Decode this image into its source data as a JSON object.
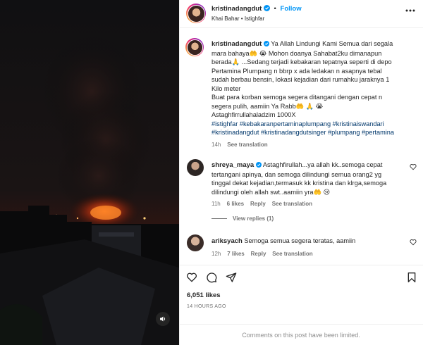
{
  "header": {
    "username": "kristinadangdut",
    "follow_label": "Follow",
    "bullet": "•",
    "subline": "Khai Bahar • Istighfar",
    "more_icon": "more-horizontal-icon"
  },
  "caption": {
    "username": "kristinadangdut",
    "lines": [
      " Ya Allah Lindungi Kami Semua dari segala",
      "mara bahaya🤲 😭 Mohon doanya Sahabat2ku dimanapun",
      "berada🙏 ...Sedang terjadi kebakaran tepatnya seperti di depo",
      "Pertamina Plumpang n bbrp x ada ledakan n asapnya tebal",
      "sudah berbau bensin, lokasi kejadian dari rumahku jaraknya 1",
      "Kilo meter",
      "Buat para korban semoga segera ditangani dengan cepat n",
      "segera pulih, aamiin Ya Rabb🤲 🙏 😭",
      "Astaghfirrullahaladzim 1000X"
    ],
    "hashtags_line1": [
      "#istighfar",
      "#kebakaranpertaminaplumpang",
      "#kristinaiswandari"
    ],
    "hashtags_line2": [
      "#kristinadangdut",
      "#kristinadangdutsinger",
      "#plumpang",
      "#pertamina"
    ],
    "time": "14h",
    "see_translation": "See translation"
  },
  "comments": [
    {
      "username": "shreya_maya",
      "lines": [
        " Astaghfirullah...ya allah kk..semoga cepat",
        "tertangani apinya, dan semoga dilindungi semua orang2 yg",
        "tinggal dekat kejadian,termasuk kk kristina dan klrga,semoga",
        "dilindungi oleh allah swt..aamiin yra🤲 😢"
      ],
      "time": "11h",
      "likes": "6 likes",
      "reply": "Reply",
      "see_translation": "See translation",
      "view_replies": "View replies (1)"
    },
    {
      "username": "ariksyach",
      "lines": [
        " Semoga semua segera teratas, aamiin"
      ],
      "time": "12h",
      "likes": "7 likes",
      "reply": "Reply",
      "see_translation": "See translation"
    }
  ],
  "actions": {
    "likes": "6,051 likes",
    "date": "14 HOURS AGO",
    "icons": [
      "heart-icon",
      "comment-icon",
      "share-icon",
      "bookmark-icon"
    ]
  },
  "footer": {
    "limited_text": "Comments on this post have been limited."
  },
  "colors": {
    "link": "#00376b",
    "follow": "#0095f6",
    "muted": "#737373",
    "verified": "#0095f6"
  }
}
